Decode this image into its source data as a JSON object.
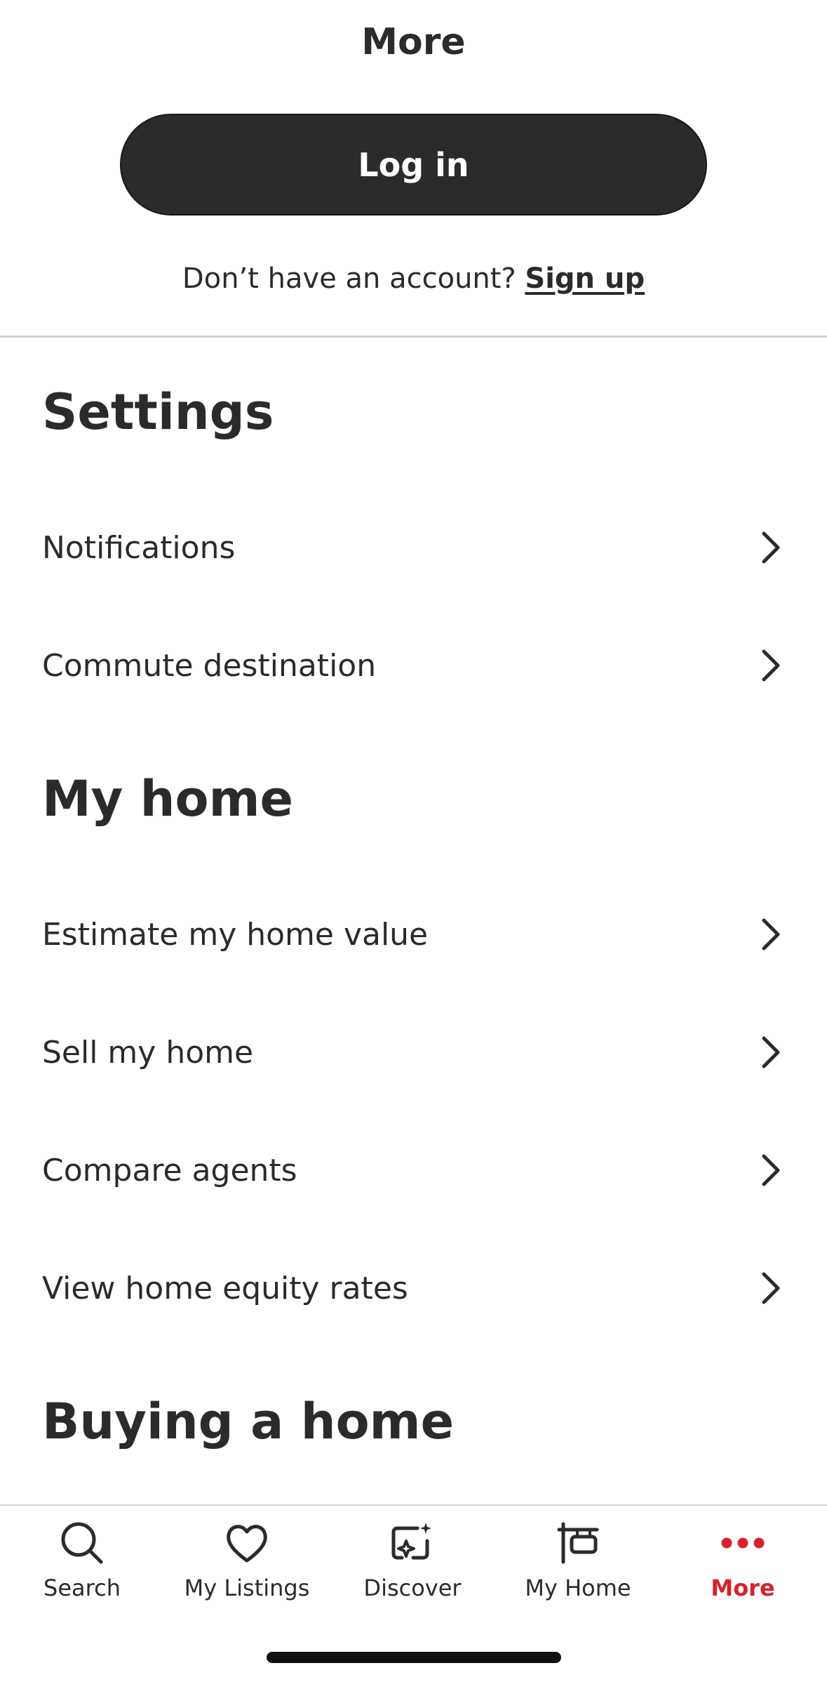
{
  "header": {
    "title": "More"
  },
  "auth": {
    "login_label": "Log in",
    "signup_prompt": "Don’t have an account?",
    "signup_link": "Sign up"
  },
  "sections": {
    "settings": {
      "title": "Settings",
      "items": [
        "Notifications",
        "Commute destination"
      ]
    },
    "my_home": {
      "title": "My home",
      "items": [
        "Estimate my home value",
        "Sell my home",
        "Compare agents",
        "View home equity rates"
      ]
    },
    "buying": {
      "title": "Buying a home"
    }
  },
  "tabbar": {
    "tabs": [
      {
        "label": "Search",
        "icon": "search-icon"
      },
      {
        "label": "My Listings",
        "icon": "heart-icon"
      },
      {
        "label": "Discover",
        "icon": "discover-icon"
      },
      {
        "label": "My Home",
        "icon": "home-sign-icon"
      },
      {
        "label": "More",
        "icon": "more-dots-icon",
        "active": true
      }
    ]
  },
  "colors": {
    "text": "#2b2b2b",
    "accent": "#d9212c",
    "button_bg": "#2b2b2b",
    "divider": "#cfcfcf"
  }
}
